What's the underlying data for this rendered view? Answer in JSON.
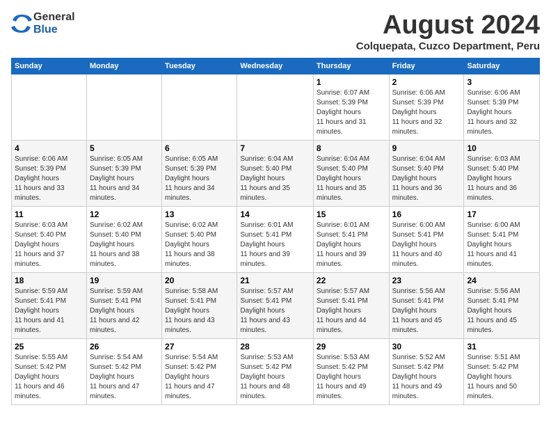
{
  "header": {
    "logo_general": "General",
    "logo_blue": "Blue",
    "title": "August 2024",
    "subtitle": "Colquepata, Cuzco Department, Peru"
  },
  "calendar": {
    "days_of_week": [
      "Sunday",
      "Monday",
      "Tuesday",
      "Wednesday",
      "Thursday",
      "Friday",
      "Saturday"
    ],
    "weeks": [
      [
        {
          "day": "",
          "info": ""
        },
        {
          "day": "",
          "info": ""
        },
        {
          "day": "",
          "info": ""
        },
        {
          "day": "",
          "info": ""
        },
        {
          "day": "1",
          "info": "Sunrise: 6:07 AM\nSunset: 5:39 PM\nDaylight: 11 hours and 31 minutes."
        },
        {
          "day": "2",
          "info": "Sunrise: 6:06 AM\nSunset: 5:39 PM\nDaylight: 11 hours and 32 minutes."
        },
        {
          "day": "3",
          "info": "Sunrise: 6:06 AM\nSunset: 5:39 PM\nDaylight: 11 hours and 32 minutes."
        }
      ],
      [
        {
          "day": "4",
          "info": "Sunrise: 6:06 AM\nSunset: 5:39 PM\nDaylight: 11 hours and 33 minutes."
        },
        {
          "day": "5",
          "info": "Sunrise: 6:05 AM\nSunset: 5:39 PM\nDaylight: 11 hours and 34 minutes."
        },
        {
          "day": "6",
          "info": "Sunrise: 6:05 AM\nSunset: 5:39 PM\nDaylight: 11 hours and 34 minutes."
        },
        {
          "day": "7",
          "info": "Sunrise: 6:04 AM\nSunset: 5:40 PM\nDaylight: 11 hours and 35 minutes."
        },
        {
          "day": "8",
          "info": "Sunrise: 6:04 AM\nSunset: 5:40 PM\nDaylight: 11 hours and 35 minutes."
        },
        {
          "day": "9",
          "info": "Sunrise: 6:04 AM\nSunset: 5:40 PM\nDaylight: 11 hours and 36 minutes."
        },
        {
          "day": "10",
          "info": "Sunrise: 6:03 AM\nSunset: 5:40 PM\nDaylight: 11 hours and 36 minutes."
        }
      ],
      [
        {
          "day": "11",
          "info": "Sunrise: 6:03 AM\nSunset: 5:40 PM\nDaylight: 11 hours and 37 minutes."
        },
        {
          "day": "12",
          "info": "Sunrise: 6:02 AM\nSunset: 5:40 PM\nDaylight: 11 hours and 38 minutes."
        },
        {
          "day": "13",
          "info": "Sunrise: 6:02 AM\nSunset: 5:40 PM\nDaylight: 11 hours and 38 minutes."
        },
        {
          "day": "14",
          "info": "Sunrise: 6:01 AM\nSunset: 5:41 PM\nDaylight: 11 hours and 39 minutes."
        },
        {
          "day": "15",
          "info": "Sunrise: 6:01 AM\nSunset: 5:41 PM\nDaylight: 11 hours and 39 minutes."
        },
        {
          "day": "16",
          "info": "Sunrise: 6:00 AM\nSunset: 5:41 PM\nDaylight: 11 hours and 40 minutes."
        },
        {
          "day": "17",
          "info": "Sunrise: 6:00 AM\nSunset: 5:41 PM\nDaylight: 11 hours and 41 minutes."
        }
      ],
      [
        {
          "day": "18",
          "info": "Sunrise: 5:59 AM\nSunset: 5:41 PM\nDaylight: 11 hours and 41 minutes."
        },
        {
          "day": "19",
          "info": "Sunrise: 5:59 AM\nSunset: 5:41 PM\nDaylight: 11 hours and 42 minutes."
        },
        {
          "day": "20",
          "info": "Sunrise: 5:58 AM\nSunset: 5:41 PM\nDaylight: 11 hours and 43 minutes."
        },
        {
          "day": "21",
          "info": "Sunrise: 5:57 AM\nSunset: 5:41 PM\nDaylight: 11 hours and 43 minutes."
        },
        {
          "day": "22",
          "info": "Sunrise: 5:57 AM\nSunset: 5:41 PM\nDaylight: 11 hours and 44 minutes."
        },
        {
          "day": "23",
          "info": "Sunrise: 5:56 AM\nSunset: 5:41 PM\nDaylight: 11 hours and 45 minutes."
        },
        {
          "day": "24",
          "info": "Sunrise: 5:56 AM\nSunset: 5:41 PM\nDaylight: 11 hours and 45 minutes."
        }
      ],
      [
        {
          "day": "25",
          "info": "Sunrise: 5:55 AM\nSunset: 5:42 PM\nDaylight: 11 hours and 46 minutes."
        },
        {
          "day": "26",
          "info": "Sunrise: 5:54 AM\nSunset: 5:42 PM\nDaylight: 11 hours and 47 minutes."
        },
        {
          "day": "27",
          "info": "Sunrise: 5:54 AM\nSunset: 5:42 PM\nDaylight: 11 hours and 47 minutes."
        },
        {
          "day": "28",
          "info": "Sunrise: 5:53 AM\nSunset: 5:42 PM\nDaylight: 11 hours and 48 minutes."
        },
        {
          "day": "29",
          "info": "Sunrise: 5:53 AM\nSunset: 5:42 PM\nDaylight: 11 hours and 49 minutes."
        },
        {
          "day": "30",
          "info": "Sunrise: 5:52 AM\nSunset: 5:42 PM\nDaylight: 11 hours and 49 minutes."
        },
        {
          "day": "31",
          "info": "Sunrise: 5:51 AM\nSunset: 5:42 PM\nDaylight: 11 hours and 50 minutes."
        }
      ]
    ]
  }
}
